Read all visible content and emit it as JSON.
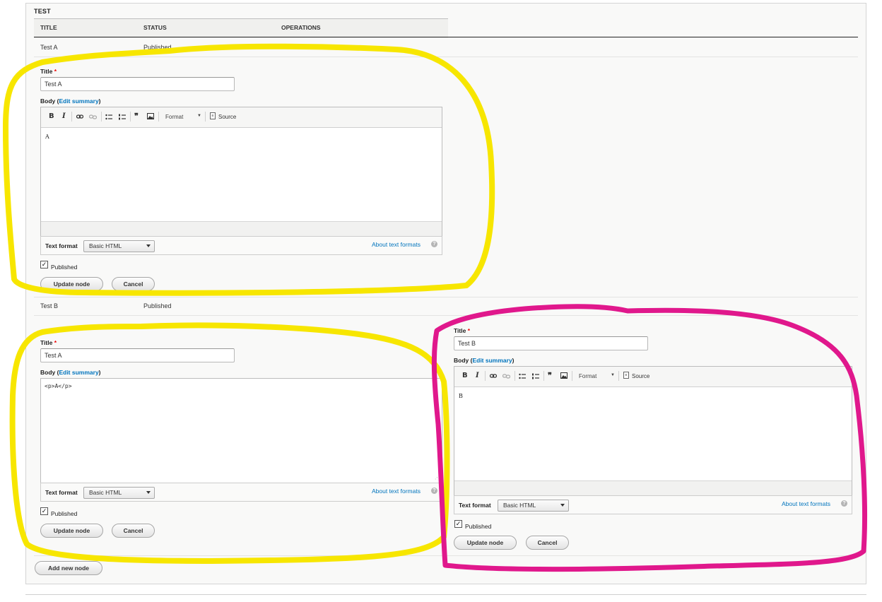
{
  "section": {
    "title": "TEST"
  },
  "table": {
    "headers": [
      "TITLE",
      "STATUS",
      "OPERATIONS"
    ],
    "rows": [
      {
        "title": "Test A",
        "status": "Published"
      },
      {
        "title": "Test B",
        "status": "Published"
      }
    ]
  },
  "form_a": {
    "title_label": "Title",
    "required_mark": "*",
    "title_value": "Test A",
    "body_label": "Body",
    "edit_summary_label": "Edit summary",
    "toolbar": {
      "bold": "B",
      "italic": "I",
      "format": "Format",
      "source": "Source"
    },
    "body_text": "A",
    "text_format_label": "Text format",
    "text_format_value": "Basic HTML",
    "about_text_formats": "About text formats",
    "published_label": "Published",
    "published_checked": true,
    "update_button": "Update node",
    "cancel_button": "Cancel"
  },
  "form_b": {
    "title_label": "Title",
    "required_mark": "*",
    "title_value": "Test A",
    "body_label": "Body",
    "edit_summary_label": "Edit summary",
    "body_source": "<p>A</p>",
    "text_format_label": "Text format",
    "text_format_value": "Basic HTML",
    "about_text_formats": "About text formats",
    "published_label": "Published",
    "published_checked": true,
    "update_button": "Update node",
    "cancel_button": "Cancel"
  },
  "form_c": {
    "title_label": "Title",
    "required_mark": "*",
    "title_value": "Test B",
    "body_label": "Body",
    "edit_summary_label": "Edit summary",
    "toolbar": {
      "bold": "B",
      "italic": "I",
      "format": "Format",
      "source": "Source"
    },
    "body_text": "B",
    "text_format_label": "Text format",
    "text_format_value": "Basic HTML",
    "about_text_formats": "About text formats",
    "published_label": "Published",
    "published_checked": true,
    "update_button": "Update node",
    "cancel_button": "Cancel"
  },
  "add_new_node": "Add new node",
  "annotation_colors": {
    "yellow": "#f7e600",
    "magenta": "#e0188c"
  }
}
